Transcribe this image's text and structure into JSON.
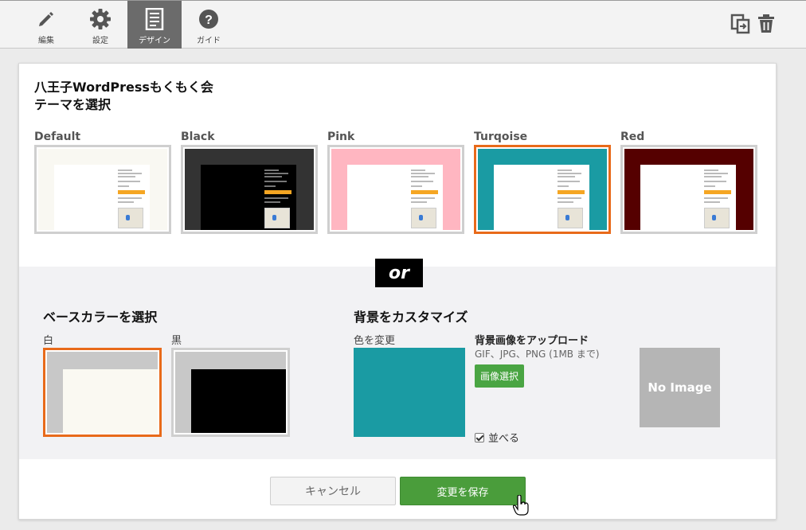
{
  "toolbar": {
    "items": [
      {
        "label": "編集",
        "icon": "pencil-icon"
      },
      {
        "label": "設定",
        "icon": "gear-icon"
      },
      {
        "label": "デザイン",
        "icon": "document-icon"
      },
      {
        "label": "ガイド",
        "icon": "help-icon"
      }
    ],
    "active": "デザイン",
    "right_icons": [
      "copy-icon",
      "trash-icon"
    ]
  },
  "header": {
    "site_name": "八王子WordPressもくもく会",
    "subtitle": "テーマを選択"
  },
  "themes": [
    {
      "name": "Default",
      "bg": "#f9f8f2",
      "page_bg": "#ffffff",
      "selected": false
    },
    {
      "name": "Black",
      "bg": "#333333",
      "page_bg": "#000000",
      "selected": false
    },
    {
      "name": "Pink",
      "bg": "#ffb6c1",
      "page_bg": "#ffffff",
      "selected": false
    },
    {
      "name": "Turqoise",
      "bg": "#1a9ba3",
      "page_bg": "#ffffff",
      "selected": true
    },
    {
      "name": "Red",
      "bg": "#550000",
      "page_bg": "#ffffff",
      "selected": false
    }
  ],
  "or_label": "or",
  "base_color": {
    "title": "ベースカラーを選択",
    "options": [
      {
        "label": "白",
        "fg": "#faf9f2",
        "selected": true
      },
      {
        "label": "黒",
        "fg": "#000000",
        "selected": false
      }
    ]
  },
  "background": {
    "title": "背景をカスタマイズ",
    "color_label": "色を変更",
    "color_value": "#1a9ba3",
    "upload_title": "背景画像をアップロード",
    "upload_note": "GIF、JPG、PNG (1MB まで)",
    "pick_button": "画像選択",
    "tile_label": "並べる",
    "tile_checked": true,
    "no_image": "No Image"
  },
  "footer": {
    "cancel": "キャンセル",
    "save": "変更を保存"
  },
  "colors": {
    "selected_border": "#e86a1a",
    "save_green": "#4a9d3b"
  }
}
